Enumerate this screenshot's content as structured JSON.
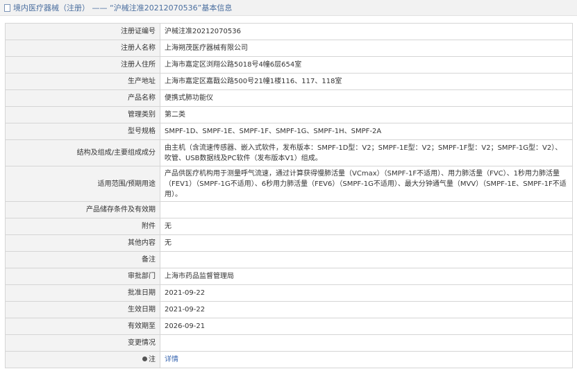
{
  "header": {
    "title": "境内医疗器械（注册） —— “沪械注准20212070536”基本信息"
  },
  "rows": [
    {
      "label": "注册证编号",
      "value": "沪械注准20212070536"
    },
    {
      "label": "注册人名称",
      "value": "上海朔茂医疗器械有限公司"
    },
    {
      "label": "注册人住所",
      "value": "上海市嘉定区浏翔公路5018号4幢6层654室"
    },
    {
      "label": "生产地址",
      "value": "上海市嘉定区嘉戬公路500号21幢1楼116、117、118室"
    },
    {
      "label": "产品名称",
      "value": "便携式肺功能仪"
    },
    {
      "label": "管理类别",
      "value": "第二类"
    },
    {
      "label": "型号规格",
      "value": "SMPF-1D、SMPF-1E、SMPF-1F、SMPF-1G、SMPF-1H、SMPF-2A"
    },
    {
      "label": "结构及组成/主要组成成分",
      "value": "由主机（含流速传感器、嵌入式软件，发布版本：SMPF-1D型：V2；SMPF-1E型：V2；SMPF-1F型：V2；SMPF-1G型：V2）、吹管、USB数据线及PC软件（发布版本V1）组成。"
    },
    {
      "label": "适用范围/预期用途",
      "value": "产品供医疗机构用于测量呼气流速，通过计算获得慢肺活量（VCmax）（SMPF-1F不适用）、用力肺活量（FVC）、1秒用力肺活量（FEV1）（SMPF-1G不适用）、6秒用力肺活量（FEV6）（SMPF-1G不适用）、最大分钟通气量（MVV）（SMPF-1E、SMPF-1F不适用）。"
    },
    {
      "label": "产品储存条件及有效期",
      "value": ""
    },
    {
      "label": "附件",
      "value": "无"
    },
    {
      "label": "其他内容",
      "value": "无"
    },
    {
      "label": "备注",
      "value": ""
    },
    {
      "label": "审批部门",
      "value": "上海市药品监督管理局"
    },
    {
      "label": "批准日期",
      "value": "2021-09-22"
    },
    {
      "label": "生效日期",
      "value": "2021-09-22"
    },
    {
      "label": "有效期至",
      "value": "2026-09-21"
    },
    {
      "label": "变更情况",
      "value": ""
    }
  ],
  "note": {
    "label": "注",
    "link_text": "详情"
  }
}
